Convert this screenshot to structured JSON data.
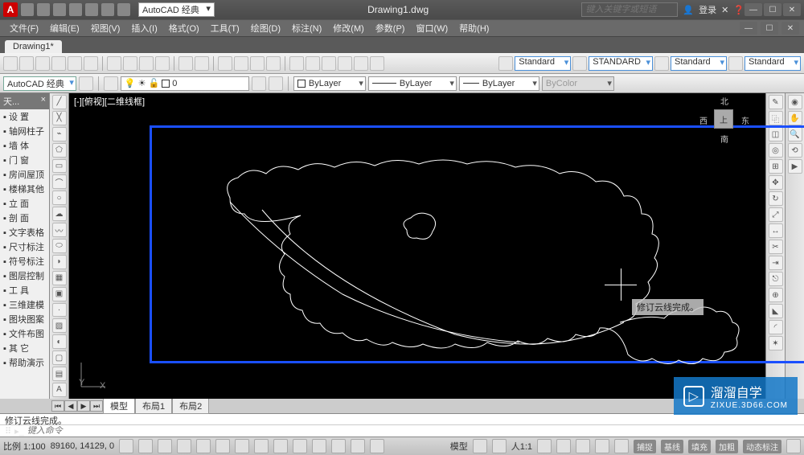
{
  "app": {
    "logo_letter": "A",
    "workspace": "AutoCAD 经典",
    "filename": "Drawing1.dwg",
    "search_placeholder": "键入关键字或短语",
    "login": "登录"
  },
  "menubar": [
    "文件(F)",
    "编辑(E)",
    "视图(V)",
    "插入(I)",
    "格式(O)",
    "工具(T)",
    "绘图(D)",
    "标注(N)",
    "修改(M)",
    "参数(P)",
    "窗口(W)",
    "帮助(H)"
  ],
  "file_tab": "Drawing1*",
  "styles": {
    "text": "Standard",
    "dim": "STANDARD",
    "table": "Standard",
    "mleader": "Standard"
  },
  "toolbar2": {
    "workspace": "AutoCAD 经典",
    "layer": "0",
    "prop_layer": "ByLayer",
    "linetype": "ByLayer",
    "lineweight": "ByLayer",
    "plotstyle": "ByColor"
  },
  "sidebar": {
    "header": "天...",
    "items": [
      "设  置",
      "轴网柱子",
      "墙  体",
      "门  窗",
      "房间屋顶",
      "楼梯其他",
      "立  面",
      "剖  面",
      "文字表格",
      "尺寸标注",
      "符号标注",
      "图层控制",
      "工  具",
      "三维建模",
      "图块图案",
      "文件布图",
      "其  它",
      "帮助演示"
    ]
  },
  "canvas": {
    "view_label": "[-][俯视][二维线框]",
    "tooltip": "修订云线完成。",
    "nav": {
      "top": "上",
      "n": "北",
      "e": "东",
      "s": "南",
      "w": "西"
    },
    "ucs": {
      "x": "X",
      "y": "Y"
    }
  },
  "layout_tabs": [
    "模型",
    "布局1",
    "布局2"
  ],
  "command": {
    "history": "修订云线完成。",
    "prompt": "键入命令"
  },
  "statusbar": {
    "scale_label": "比例 1:100",
    "coords": "89160, 14129, 0",
    "model": "模型",
    "ann_scale": "人1:1",
    "toggles": [
      "捕捉",
      "基线",
      "填充",
      "加粗",
      "动态标注"
    ]
  },
  "watermark": {
    "brand": "溜溜自学",
    "sub": "ZIXUE.3D66.COM"
  }
}
